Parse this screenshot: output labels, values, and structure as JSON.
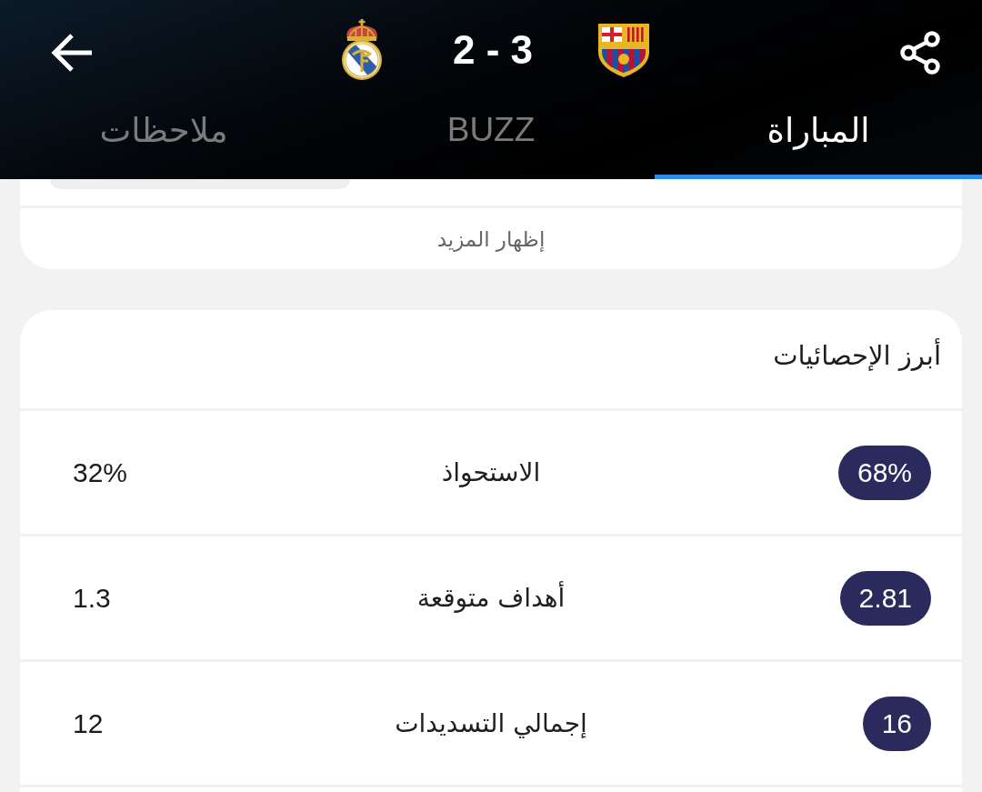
{
  "header": {
    "score": "2 - 3"
  },
  "tabs": [
    {
      "label": "المباراة",
      "selected": true
    },
    {
      "label": "BUZZ",
      "selected": false
    },
    {
      "label": "ملاحظات",
      "selected": false
    }
  ],
  "previous_card": {
    "show_more": "إظهار المزيد"
  },
  "stats_card": {
    "title": "أبرز الإحصائيات",
    "rows": [
      {
        "label": "الاستحواذ",
        "home": {
          "value": "68%",
          "highlighted": true
        },
        "away": {
          "value": "32%",
          "highlighted": false
        }
      },
      {
        "label": "أهداف متوقعة",
        "home": {
          "value": "2.81",
          "highlighted": true
        },
        "away": {
          "value": "1.3",
          "highlighted": false
        }
      },
      {
        "label": "إجمالي التسديدات",
        "home": {
          "value": "16",
          "highlighted": true
        },
        "away": {
          "value": "12",
          "highlighted": false
        }
      }
    ]
  }
}
